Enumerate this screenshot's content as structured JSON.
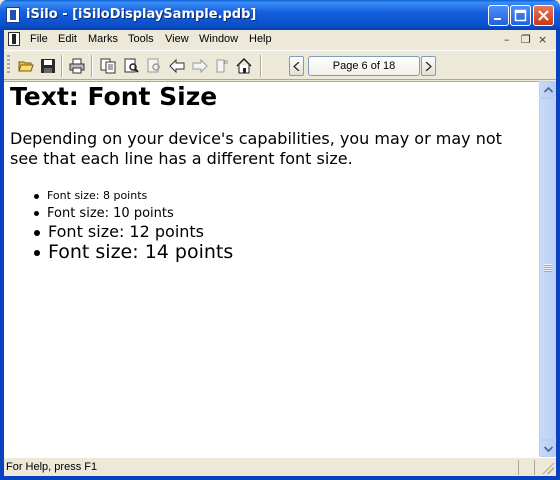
{
  "window": {
    "title": "iSilo - [iSiloDisplaySample.pdb]"
  },
  "menu": {
    "items": [
      "File",
      "Edit",
      "Marks",
      "Tools",
      "View",
      "Window",
      "Help"
    ]
  },
  "toolbar": {
    "icons": [
      "open-folder-icon",
      "save-icon",
      "print-icon",
      "copy-icon",
      "find-icon",
      "find-next-icon",
      "back-arrow-icon",
      "forward-arrow-icon",
      "bookmark-icon",
      "home-icon"
    ],
    "page_label": "Page 6 of 18"
  },
  "content": {
    "heading": "Text: Font Size",
    "paragraph": "Depending on your device's capabilities, you may or may not see that each line has a different font size.",
    "bullets": [
      "Font size: 8 points",
      "Font size: 10 points",
      "Font size: 12 points",
      "Font size: 14 points"
    ]
  },
  "status": {
    "text": "For Help, press F1"
  },
  "colors": {
    "titlebar": "#0a4fc9",
    "window_bg": "#ece9d8",
    "scrollbar": "#c9daf8"
  }
}
